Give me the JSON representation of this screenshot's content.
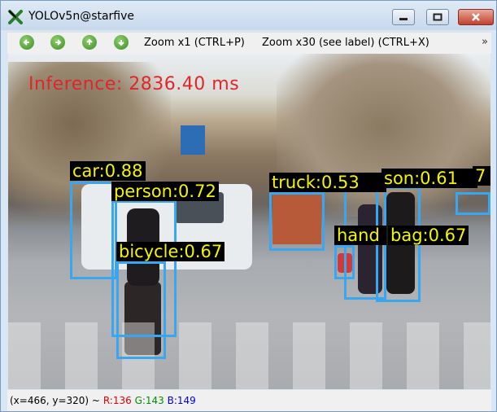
{
  "window": {
    "title": "YOLOv5n@starfive"
  },
  "toolbar": {
    "buttons": [
      {
        "icon": "arrow-left-icon",
        "glyph": "←"
      },
      {
        "icon": "arrow-right-icon",
        "glyph": "→"
      },
      {
        "icon": "arrow-up-icon",
        "glyph": "↑"
      },
      {
        "icon": "arrow-down-icon",
        "glyph": "↓"
      }
    ],
    "zoom1_label": "Zoom x1 (CTRL+P)",
    "zoom30_label": "Zoom x30 (see label) (CTRL+X)",
    "more_label": "»"
  },
  "image": {
    "inference_text": "Inference: 2836.40 ms",
    "detections": [
      {
        "label": "car:0.88"
      },
      {
        "label": "person:0.72"
      },
      {
        "label": "bicycle:0.67"
      },
      {
        "label": "truck:0.53"
      },
      {
        "label": "son:0.61"
      },
      {
        "label": "7"
      },
      {
        "label": "hand"
      },
      {
        "label": "bag:0.67"
      }
    ]
  },
  "status": {
    "coords": "(x=466, y=320) ~",
    "r": "R:136",
    "g": "G:143",
    "b": "B:149"
  },
  "colors": {
    "box": "#39a6f0",
    "label_text": "#f5f500",
    "inference_text": "#e0262a"
  }
}
